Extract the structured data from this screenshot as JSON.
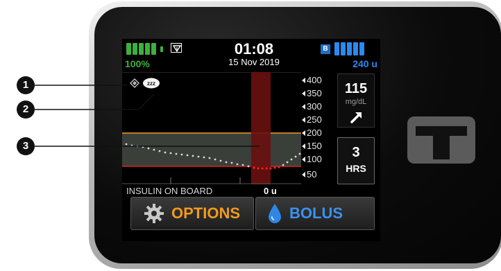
{
  "status": {
    "battery_percent": "100%",
    "time": "01:08",
    "date": "15 Nov 2019",
    "insulin_badge": "B",
    "insulin_units": "240 u"
  },
  "cgm": {
    "reading": "115",
    "unit": "mg/dL",
    "trend": "rising",
    "scale_labels": [
      "400",
      "350",
      "300",
      "250",
      "200",
      "150",
      "100",
      "50"
    ],
    "target_range_mgdl": [
      70,
      180
    ],
    "colors": {
      "high_line": "#f0a020",
      "low_line": "#e02020",
      "target_band": "#3a3f3a",
      "sleep_band": "#6a1010"
    }
  },
  "graph_button": {
    "value": "3",
    "label": "HRS"
  },
  "insulin_on_board": {
    "label": "INSULIN ON BOARD",
    "value": "0 u"
  },
  "buttons": {
    "options": "OPTIONS",
    "bolus": "BOLUS"
  },
  "icons": [
    "signal-icon",
    "diamond-icon",
    "sleep-icon",
    "trend-arrow-icon",
    "gear-icon",
    "droplet-icon",
    "t-logo-icon"
  ],
  "callouts": [
    "1",
    "2",
    "3"
  ]
}
